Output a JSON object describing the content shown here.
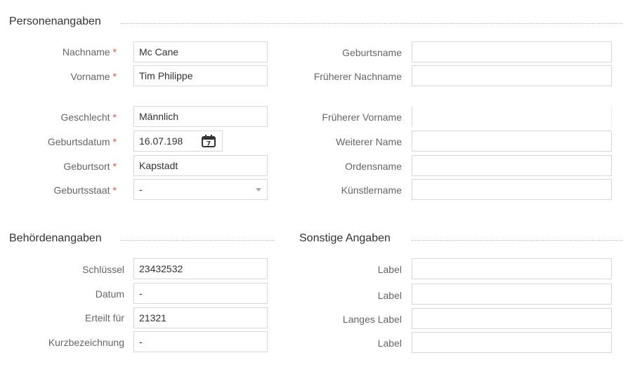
{
  "sections": {
    "personal": "Personenangaben",
    "authority": "Behördenangaben",
    "other": "Sonstige Angaben"
  },
  "required_marker": "*",
  "personal_left": [
    {
      "label": "Nachname",
      "value": "Mc Cane",
      "required": true
    },
    {
      "label": "Vorname",
      "value": "Tim Philippe",
      "required": true
    },
    {
      "label": "Geschlecht",
      "value": "Männlich",
      "required": true
    },
    {
      "label": "Geburtsdatum",
      "value": "16.07.198",
      "required": true
    },
    {
      "label": "Geburtsort",
      "value": "Kapstadt",
      "required": true
    },
    {
      "label": "Geburtsstaat",
      "value": "-",
      "required": true
    }
  ],
  "personal_right": [
    {
      "label": "Geburtsname",
      "value": ""
    },
    {
      "label": "Früherer Nachname",
      "value": ""
    },
    {
      "label": "Früherer Vorname",
      "value": ""
    },
    {
      "label": "Weiterer Name",
      "value": ""
    },
    {
      "label": "Ordensname",
      "value": ""
    },
    {
      "label": "Künstlername",
      "value": ""
    }
  ],
  "authority": [
    {
      "label": "Schlüssel",
      "value": "23432532"
    },
    {
      "label": "Datum",
      "value": "-"
    },
    {
      "label": "Erteilt für",
      "value": "21321"
    },
    {
      "label": "Kurzbezeichnung",
      "value": "-"
    }
  ],
  "other": [
    {
      "label": "Label",
      "value": ""
    },
    {
      "label": "Label",
      "value": ""
    },
    {
      "label": "Langes Label",
      "value": ""
    },
    {
      "label": "Label",
      "value": ""
    }
  ],
  "icons": {
    "calendar": "calendar-icon",
    "dropdown": "chevron-down-icon"
  },
  "colors": {
    "required": "#d9534f",
    "border": "#d7d7d7"
  }
}
